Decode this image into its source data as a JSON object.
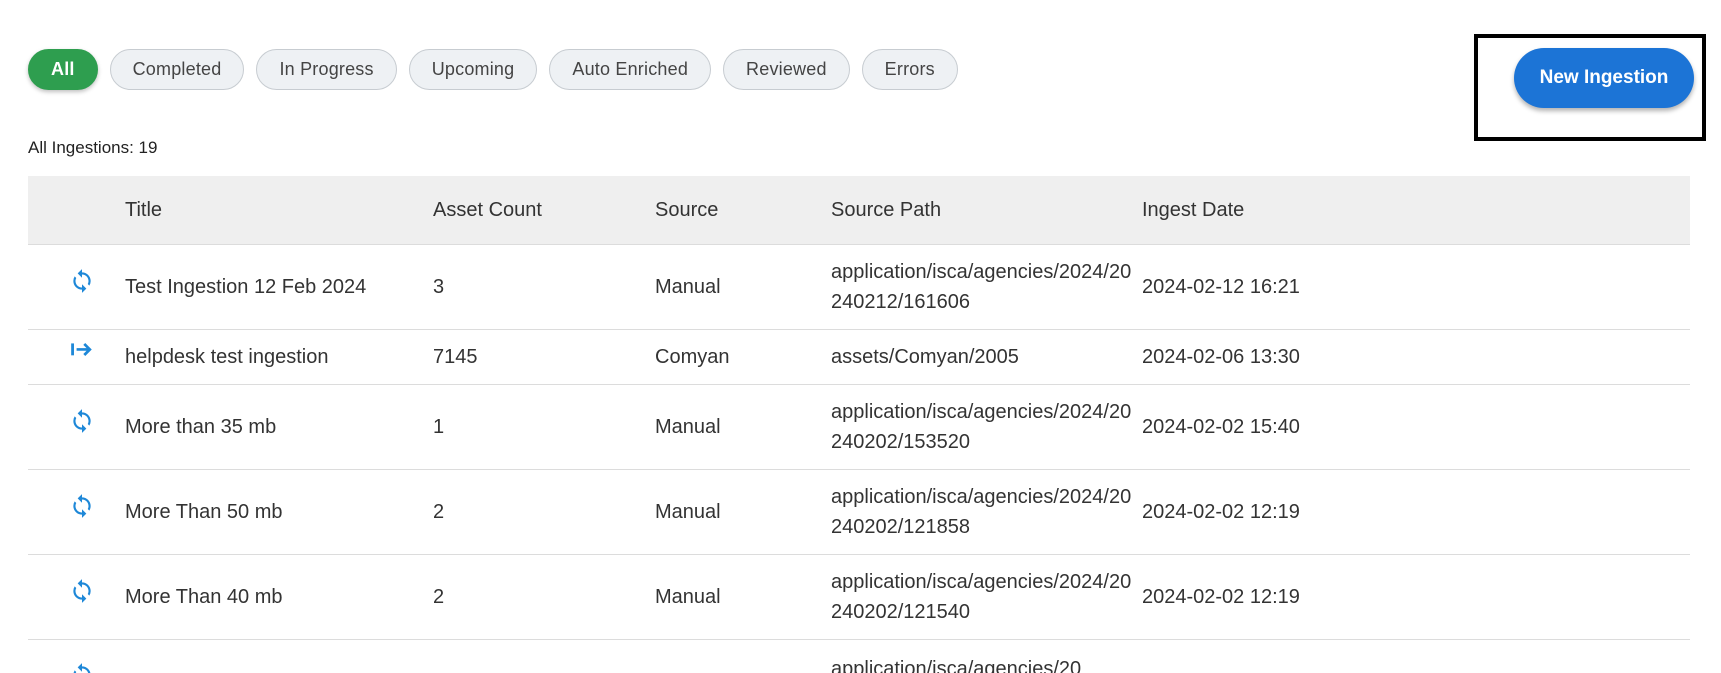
{
  "filters": [
    "All",
    "Completed",
    "In Progress",
    "Upcoming",
    "Auto Enriched",
    "Reviewed",
    "Errors"
  ],
  "actions": {
    "new_ingestion": "New Ingestion"
  },
  "summary": {
    "count_text": "All Ingestions: 19"
  },
  "table": {
    "headers": {
      "title": "Title",
      "asset_count": "Asset Count",
      "source": "Source",
      "source_path": "Source Path",
      "ingest_date": "Ingest Date"
    },
    "rows": [
      {
        "icon": "sync-icon",
        "title": "Test Ingestion 12 Feb 2024",
        "asset_count": "3",
        "source": "Manual",
        "source_path": "application/isca/agencies/2024/20240212/161606",
        "ingest_date": "2024-02-12 16:21"
      },
      {
        "icon": "arrow-right-to-bar-icon",
        "title": "helpdesk test ingestion",
        "asset_count": "7145",
        "source": "Comyan",
        "source_path": "assets/Comyan/2005",
        "ingest_date": "2024-02-06 13:30"
      },
      {
        "icon": "sync-icon",
        "title": "More than 35 mb",
        "asset_count": "1",
        "source": "Manual",
        "source_path": "application/isca/agencies/2024/20240202/153520",
        "ingest_date": "2024-02-02 15:40"
      },
      {
        "icon": "sync-icon",
        "title": "More Than 50 mb",
        "asset_count": "2",
        "source": "Manual",
        "source_path": "application/isca/agencies/2024/20240202/121858",
        "ingest_date": "2024-02-02 12:19"
      },
      {
        "icon": "sync-icon",
        "title": "More Than 40 mb",
        "asset_count": "2",
        "source": "Manual",
        "source_path": "application/isca/agencies/2024/20240202/121540",
        "ingest_date": "2024-02-02 12:19"
      },
      {
        "icon": "sync-icon",
        "title": "",
        "asset_count": "",
        "source": "",
        "source_path": "application/isca/agencies/20",
        "ingest_date": ""
      }
    ]
  },
  "colors": {
    "active_chip": "#2e9e4f",
    "primary_button": "#1c74d6",
    "icon_blue": "#1e88d8"
  }
}
